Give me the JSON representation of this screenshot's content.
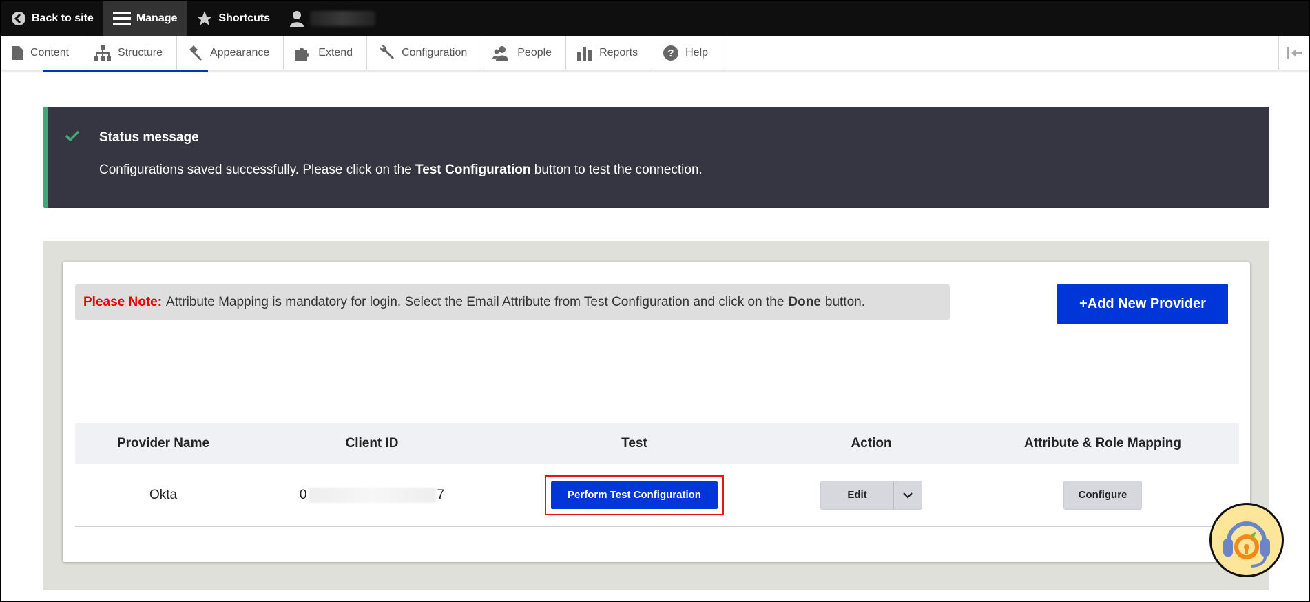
{
  "toolbar": {
    "back_label": "Back to site",
    "manage_label": "Manage",
    "shortcuts_label": "Shortcuts"
  },
  "tray": {
    "items": [
      {
        "label": "Content",
        "icon": "file-icon"
      },
      {
        "label": "Structure",
        "icon": "sitemap-icon"
      },
      {
        "label": "Appearance",
        "icon": "paintbrush-icon"
      },
      {
        "label": "Extend",
        "icon": "puzzle-icon"
      },
      {
        "label": "Configuration",
        "icon": "wrench-icon"
      },
      {
        "label": "People",
        "icon": "people-icon"
      },
      {
        "label": "Reports",
        "icon": "bar-chart-icon"
      },
      {
        "label": "Help",
        "icon": "help-icon"
      }
    ]
  },
  "status": {
    "title": "Status message",
    "text_before": "Configurations saved successfully. Please click on the",
    "text_bold": "Test Configuration",
    "text_after": "button to test the connection.",
    "accent_color": "#42a877"
  },
  "note": {
    "label": "Please Note:",
    "text_before": "Attribute Mapping is mandatory for login. Select the Email Attribute from Test Configuration and click on the",
    "text_bold": "Done",
    "text_after": "button."
  },
  "add_provider_label": "+Add New Provider",
  "table": {
    "headers": [
      "Provider Name",
      "Client ID",
      "Test",
      "Action",
      "Attribute & Role Mapping"
    ],
    "rows": [
      {
        "provider": "Okta",
        "client_id_start": "0",
        "client_id_end": "7",
        "test_label": "Perform Test Configuration",
        "action_label": "Edit",
        "mapping_label": "Configure"
      }
    ]
  },
  "colors": {
    "primary_button": "#0036d8",
    "highlight_outline": "#e8141a",
    "note_red": "#e50000"
  }
}
